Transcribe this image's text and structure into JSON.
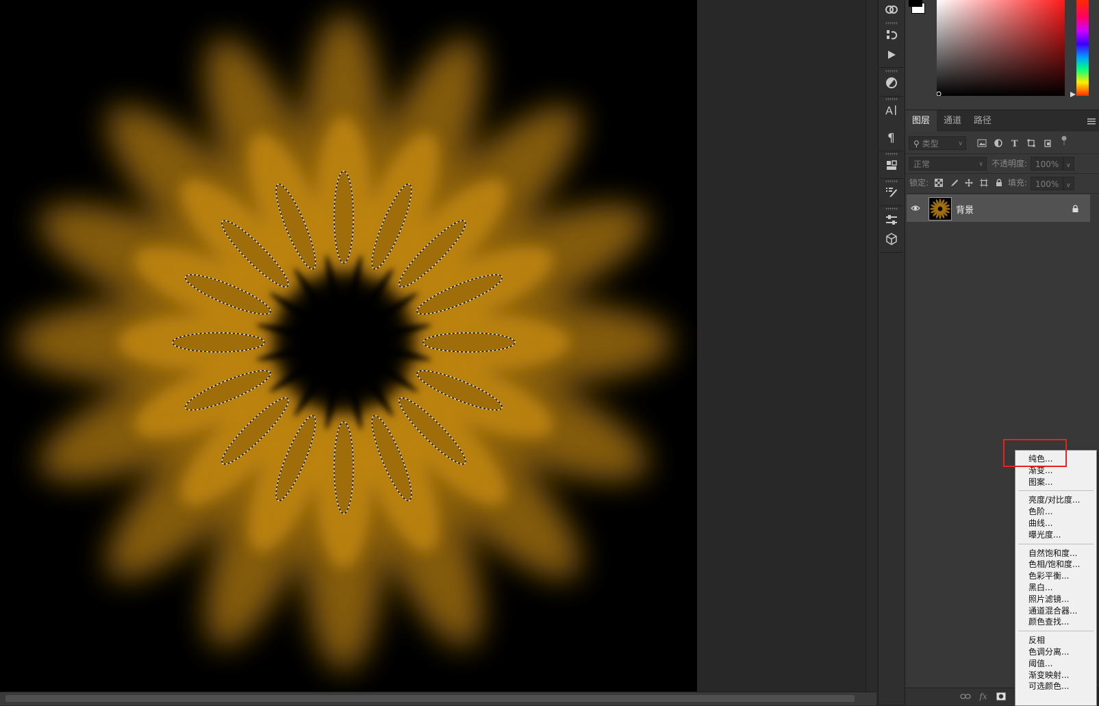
{
  "layers_panel": {
    "tabs": [
      "图层",
      "通道",
      "路径"
    ],
    "active_tab": 0,
    "filter_kind": "类型",
    "blend_mode": "正常",
    "opacity_label": "不透明度:",
    "opacity_value": "100%",
    "lock_label": "锁定:",
    "fill_label": "填充:",
    "fill_value": "100%",
    "layers": [
      {
        "name": "背景",
        "visible": true,
        "locked": true
      }
    ]
  },
  "adjustment_menu": {
    "groups": [
      [
        "纯色...",
        "渐变...",
        "图案..."
      ],
      [
        "亮度/对比度...",
        "色阶...",
        "曲线...",
        "曝光度..."
      ],
      [
        "自然饱和度...",
        "色相/饱和度...",
        "色彩平衡...",
        "黑白...",
        "照片滤镜...",
        "通道混合器...",
        "颜色查找..."
      ],
      [
        "反相",
        "色调分离...",
        "阈值...",
        "渐变映射...",
        "可选颜色..."
      ]
    ],
    "highlighted_item": "纯色..."
  },
  "colors": {
    "canvas_bg": "#000000",
    "flower_glow": "#b07a10",
    "highlight": "#e8231f",
    "foreground": "#000000",
    "background": "#ffffff"
  },
  "tool_icons": [
    "creative-cloud-icon",
    "history-icon",
    "actions-play-icon",
    "adjustments-icon",
    "character-icon",
    "paragraph-icon",
    "libraries-icon",
    "brush-settings-icon",
    "properties-icon",
    "3d-icon"
  ]
}
